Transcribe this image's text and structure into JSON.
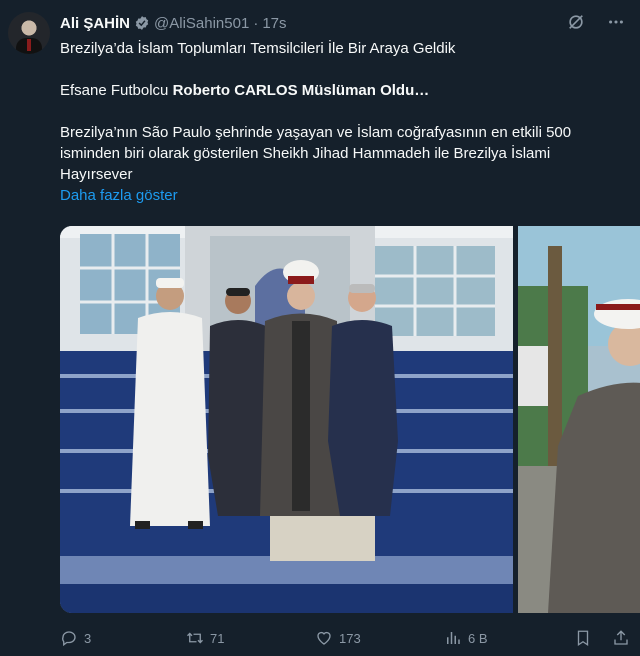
{
  "author": {
    "name": "Ali ŞAHİN",
    "handle": "@AliSahin501",
    "separator": "·",
    "time": "17s",
    "verified": true
  },
  "tweet": {
    "line1": "Brezilya’da İslam Toplumları Temsilcileri İle Bir Araya Geldik",
    "line2_prefix": "Efsane Futbolcu ",
    "line2_bold": "Roberto CARLOS Müslüman Oldu…",
    "line3": "Brezilya’nın São Paulo şehrinde yaşayan ve İslam coğrafyasının en etkili 500 isminden biri olarak gösterilen Sheikh Jihad Hammadeh ile Brezilya İslami Hayırsever",
    "show_more": "Daha fazla göster"
  },
  "metrics": {
    "replies": "3",
    "retweets": "71",
    "likes": "173",
    "views": "6 B"
  },
  "icons": {
    "grok": "grok-icon",
    "more": "more-dots-icon",
    "reply": "reply-icon",
    "retweet": "retweet-icon",
    "like": "heart-icon",
    "views": "views-icon",
    "bookmark": "bookmark-icon",
    "share": "share-icon"
  },
  "colors": {
    "background": "#15202b",
    "link": "#1d9bf0",
    "muted": "#8b98a5",
    "text": "#f7f9f9"
  }
}
